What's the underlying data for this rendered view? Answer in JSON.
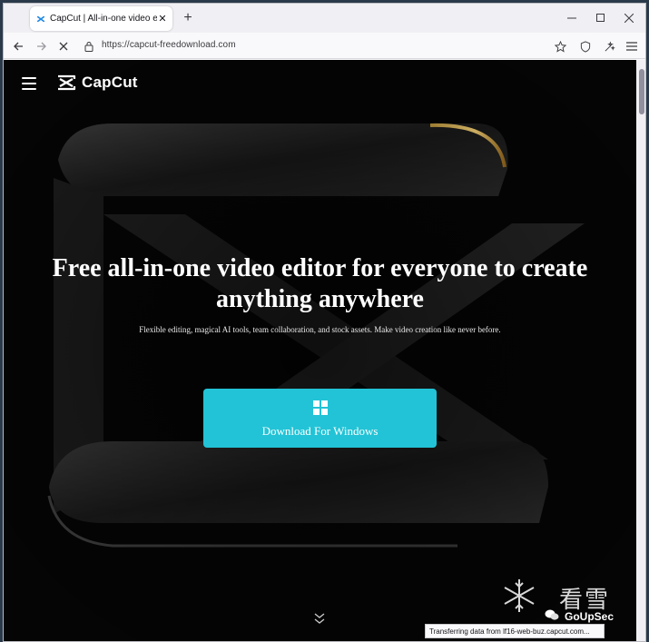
{
  "browser": {
    "tab": {
      "title": "CapCut | All-in-one video editor",
      "close_glyph": "✕"
    },
    "new_tab_glyph": "+",
    "url": "https://capcut-freedownload.com",
    "status_text": "Transferring data from lf16-web-buz.capcut.com...",
    "icons": [
      "back-icon",
      "forward-icon",
      "stop-loading-icon",
      "lock-icon",
      "bookmark-star-icon",
      "shield-icon",
      "extensions-icon",
      "menu-icon",
      "minimize-icon",
      "maximize-icon",
      "close-icon"
    ]
  },
  "page": {
    "brand": "CapCut",
    "headline": "Free all-in-one video editor for everyone to create anything anywhere",
    "subline": "Flexible editing, magical AI tools, team collaboration, and stock assets. Make video creation like never before.",
    "download_label": "Download For Windows",
    "colors": {
      "accent": "#22c3d6",
      "background": "#050505",
      "text": "#ffffff"
    }
  },
  "watermark": {
    "cjk": "看雪",
    "text": "GoUpSec"
  }
}
